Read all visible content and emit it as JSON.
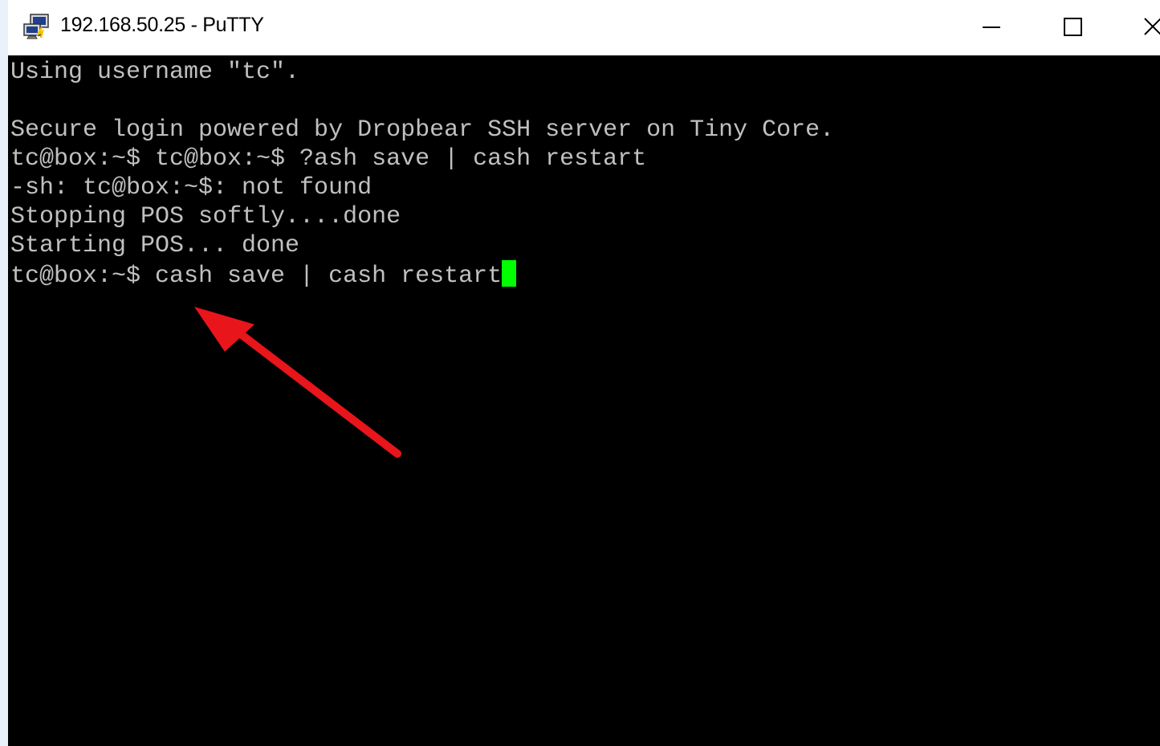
{
  "window": {
    "title": "192.168.50.25 - PuTTY",
    "app_icon": "putty-icon",
    "controls": {
      "minimize_icon": "minimize-icon",
      "maximize_icon": "maximize-icon",
      "close_icon": "close-icon"
    }
  },
  "terminal": {
    "background": "#000000",
    "text_color": "#c0c0c0",
    "cursor_color": "#00ff00",
    "lines": [
      "Using username \"tc\".",
      "",
      "Secure login powered by Dropbear SSH server on Tiny Core.",
      "tc@box:~$ tc@box:~$ ?ash save | cash restart",
      "-sh: tc@box:~$: not found",
      "Stopping POS softly....done",
      "Starting POS... done",
      "tc@box:~$ cash save | cash restart"
    ]
  },
  "annotation": {
    "arrow_color": "#e8151b",
    "arrow_icon": "red-arrow-annotation"
  }
}
